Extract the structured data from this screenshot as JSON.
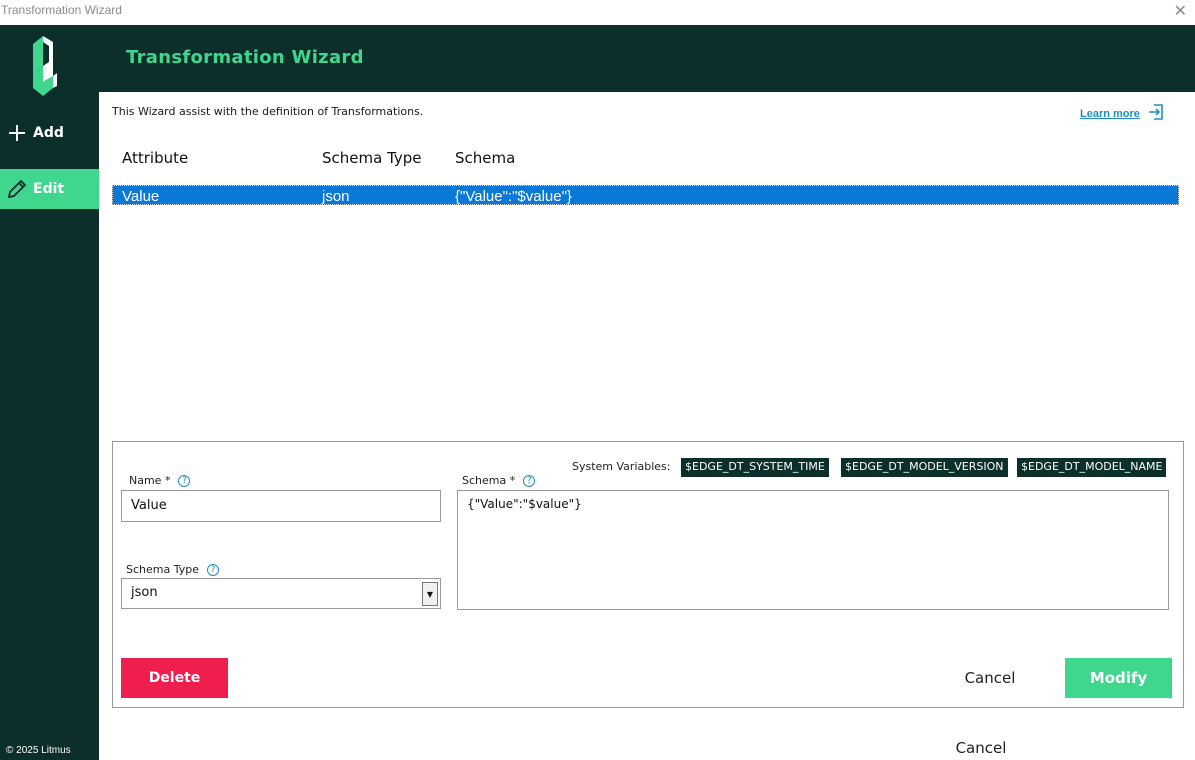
{
  "window": {
    "title": "Transformation Wizard",
    "close_glyph": "✕"
  },
  "sidebar": {
    "logo_icon": "litmus-logo-icon",
    "items": [
      {
        "label": "Add",
        "icon": "plus-icon",
        "active": false
      },
      {
        "label": "Edit",
        "icon": "pencil-icon",
        "active": true
      }
    ],
    "copyright": "© 2025 Litmus"
  },
  "header": {
    "title": "Transformation Wizard"
  },
  "intro": {
    "text": "This Wizard assist with the definition of Transformations.",
    "learn_more": "Learn more",
    "learn_more_icon": "external-link-icon"
  },
  "table": {
    "columns": [
      "Attribute",
      "Schema Type",
      "Schema"
    ],
    "rows": [
      {
        "attribute": "Value",
        "schema_type": "json",
        "schema": "{\"Value\":\"$value\"}",
        "selected": true
      }
    ]
  },
  "form": {
    "system_variables_label": "System Variables:",
    "system_variables": [
      "$EDGE_DT_SYSTEM_TIME",
      "$EDGE_DT_MODEL_VERSION",
      "$EDGE_DT_MODEL_NAME"
    ],
    "name_label": "Name *",
    "name_value": "Value",
    "schema_type_label": "Schema Type",
    "schema_type_value": "json",
    "schema_label": "Schema *",
    "schema_value": "{\"Value\":\"$value\"}",
    "help_glyph": "?"
  },
  "buttons": {
    "delete": "Delete",
    "cancel": "Cancel",
    "modify": "Modify",
    "footer_cancel": "Cancel"
  },
  "colors": {
    "brand_dark": "#0c2f2b",
    "brand_green": "#3fd68d",
    "danger": "#f01d4f",
    "selection": "#0a78d6",
    "link": "#1e8fbf"
  }
}
